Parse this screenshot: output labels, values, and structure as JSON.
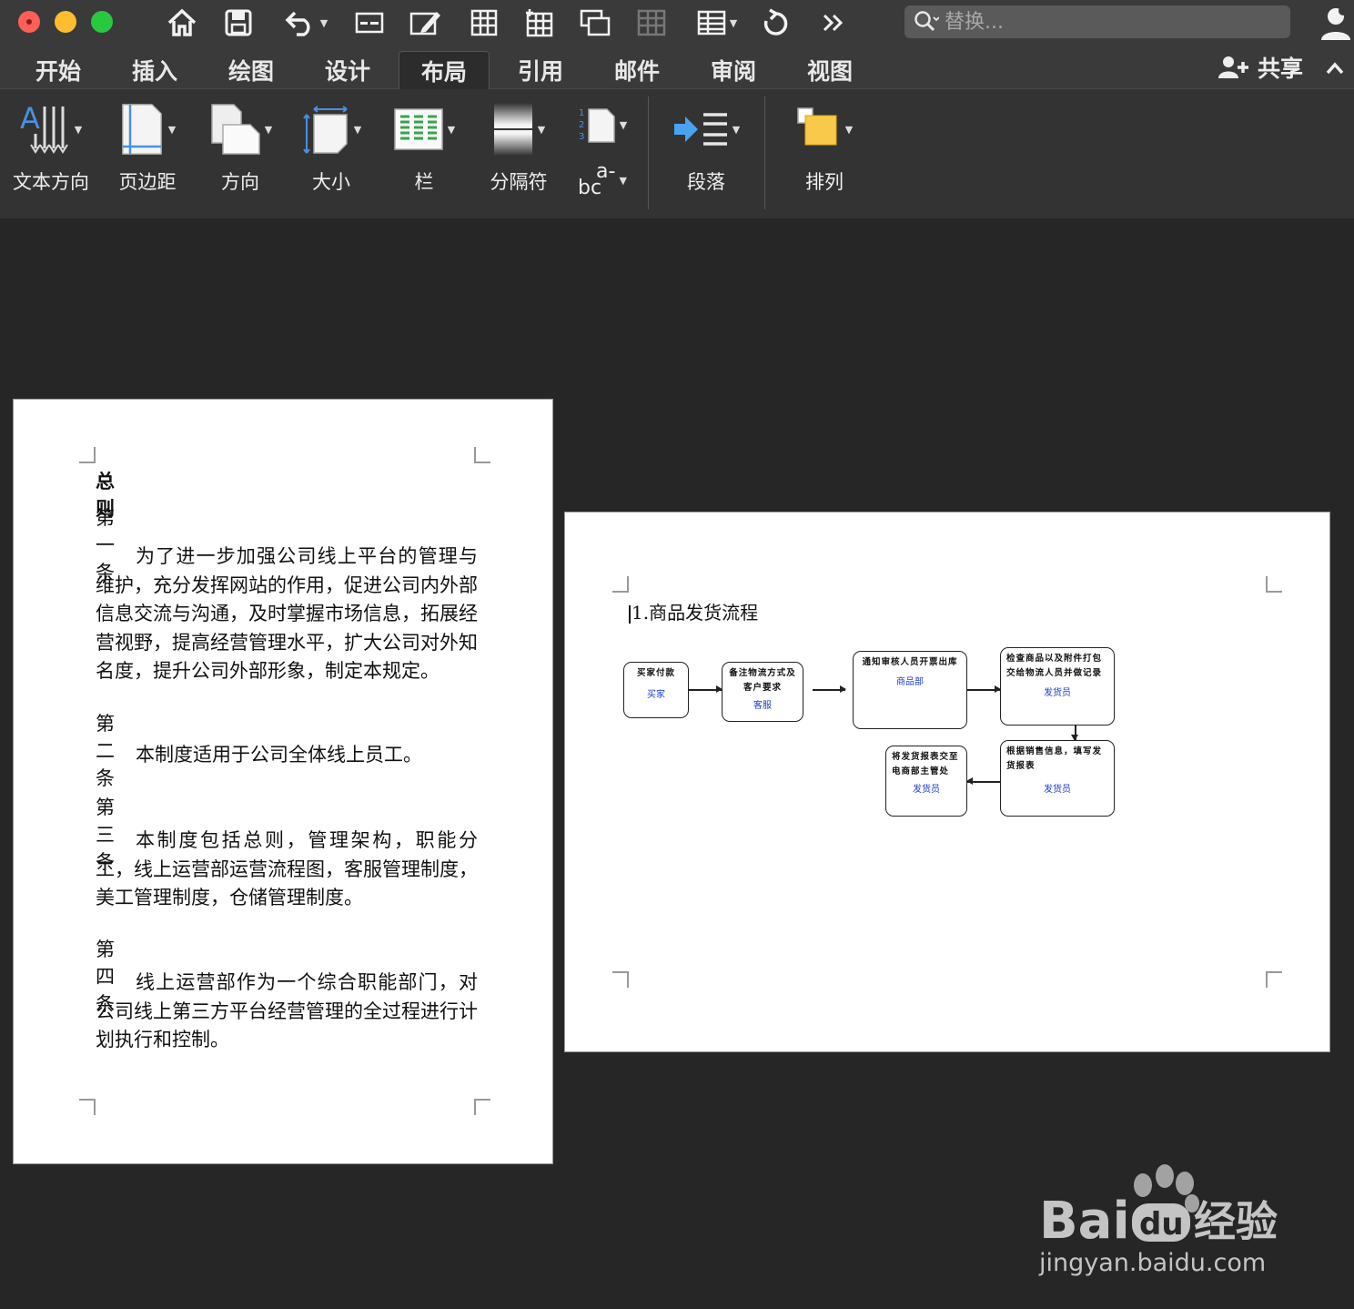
{
  "toolbar": {
    "search_placeholder": "替换..."
  },
  "tabs": [
    "开始",
    "插入",
    "绘图",
    "设计",
    "布局",
    "引用",
    "邮件",
    "审阅",
    "视图"
  ],
  "active_tab": "布局",
  "share_label": "共享",
  "ribbon": {
    "text_direction": "文本方向",
    "margins": "页边距",
    "orientation": "方向",
    "size": "大小",
    "columns": "栏",
    "breaks": "分隔符",
    "hyphenation_glyph_top": "a-",
    "hyphenation_glyph_bottom": "bc",
    "paragraph": "段落",
    "arrange": "排列",
    "text_dir_glyph": "A"
  },
  "page1": {
    "heading": "总则",
    "articles": [
      {
        "title": "第一条",
        "text": "为了进一步加强公司线上平台的管理与维护，充分发挥网站的作用，促进公司内外部信息交流与沟通，及时掌握市场信息，拓展经营视野，提高经营管理水平，扩大公司对外知名度，提升公司外部形象，制定本规定。"
      },
      {
        "title": "第二条",
        "text": "本制度适用于公司全体线上员工。"
      },
      {
        "title": "第三条",
        "text": "本制度包括总则，管理架构，职能分工，线上运营部运营流程图，客服管理制度，美工管理制度，仓储管理制度。"
      },
      {
        "title": "第四条",
        "text": "线上运营部作为一个综合职能部门，对公司线上第三方平台经营管理的全过程进行计划执行和控制。"
      }
    ]
  },
  "page2": {
    "title": "1.商品发货流程",
    "boxes": [
      {
        "text": "买家付款",
        "role": "买家"
      },
      {
        "text": "备注物流方式及客户要求",
        "role": "客服"
      },
      {
        "text": "通知审核人员开票出库",
        "role": "商品部"
      },
      {
        "text": "检查商品以及附件打包交给物流人员并做记录",
        "role": "发货员"
      },
      {
        "text": "根据销售信息，填写发货报表",
        "role": "发货员"
      },
      {
        "text": "将发货报表交至电商部主管处",
        "role": "发货员"
      }
    ]
  },
  "watermark": {
    "brand": "Bai",
    "brand2": "du",
    "cn": "经验",
    "url": "jingyan.baidu.com"
  },
  "colors": {
    "app_bg": "#262626",
    "chrome": "#3a3a3a",
    "ribbon": "#333333",
    "link_blue": "#1a3ccc"
  }
}
